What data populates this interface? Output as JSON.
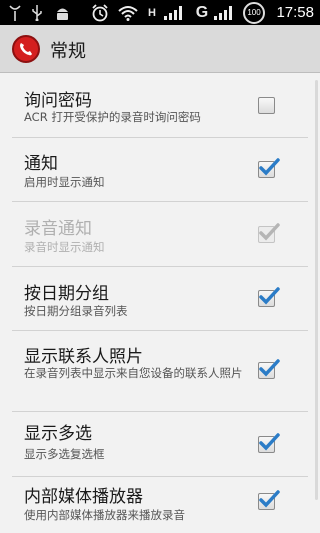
{
  "status_bar": {
    "time": "17:58",
    "battery": "100",
    "network": "G",
    "icons": [
      "antenna-icon",
      "usb-icon",
      "android-icon",
      "alarm-icon",
      "wifi-icon",
      "h-signal-icon",
      "signal-icon",
      "g-signal-icon",
      "battery-icon"
    ]
  },
  "action_bar": {
    "title": "常规",
    "logo_color": "#d41f1f"
  },
  "preferences": [
    {
      "title": "询问密码",
      "summary": "ACR 打开受保护的录音时询问密码",
      "checked": false,
      "enabled": true
    },
    {
      "title": "通知",
      "summary": "启用时显示通知",
      "checked": true,
      "enabled": true
    },
    {
      "title": "录音通知",
      "summary": "录音时显示通知",
      "checked": true,
      "enabled": false
    },
    {
      "title": "按日期分组",
      "summary": "按日期分组录音列表",
      "checked": true,
      "enabled": true
    },
    {
      "title": "显示联系人照片",
      "summary": "在录音列表中显示来自您设备的联系人照片",
      "checked": true,
      "enabled": true
    },
    {
      "title": "显示多选",
      "summary": "显示多选复选框",
      "checked": true,
      "enabled": true
    },
    {
      "title": "内部媒体播放器",
      "summary": "使用内部媒体播放器来播放录音",
      "checked": true,
      "enabled": true
    }
  ],
  "colors": {
    "check": "#2b7cc7",
    "check_disabled": "#b5b5b5"
  }
}
